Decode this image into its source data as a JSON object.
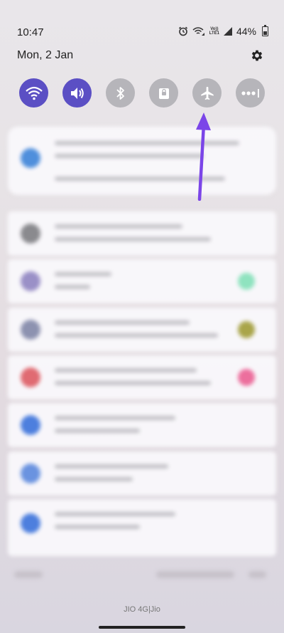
{
  "status_bar": {
    "time": "10:47",
    "volte_line1": "Vo))",
    "volte_line2": "LTE1",
    "battery": "44%"
  },
  "header": {
    "date": "Mon, 2 Jan"
  },
  "quick_settings": {
    "tiles": [
      {
        "name": "wifi",
        "icon": "wifi-icon",
        "active": true
      },
      {
        "name": "sound",
        "icon": "volume-icon",
        "active": true
      },
      {
        "name": "bluetooth",
        "icon": "bluetooth-icon",
        "active": false
      },
      {
        "name": "lock-rotation",
        "icon": "lock-icon",
        "active": false
      },
      {
        "name": "airplane-mode",
        "icon": "airplane-icon",
        "active": false
      },
      {
        "name": "more",
        "icon": "more-icon",
        "active": false
      }
    ],
    "active_color": "#5b4fc4",
    "inactive_color": "#b6b5ba"
  },
  "annotation": {
    "arrow_color": "#7b45e8"
  },
  "footer": {
    "carrier": "JIO 4G|Jio"
  }
}
